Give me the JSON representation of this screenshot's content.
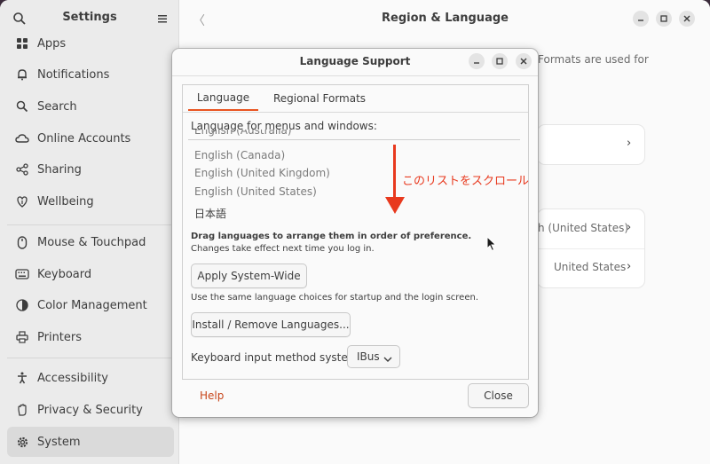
{
  "sidebar": {
    "title": "Settings",
    "items": [
      {
        "label": "Apps",
        "icon": "apps-icon"
      },
      {
        "label": "Notifications",
        "icon": "bell-icon"
      },
      {
        "label": "Search",
        "icon": "search-icon"
      },
      {
        "label": "Online Accounts",
        "icon": "cloud-icon"
      },
      {
        "label": "Sharing",
        "icon": "share-icon"
      },
      {
        "label": "Wellbeing",
        "icon": "wellbeing-icon"
      },
      {
        "label": "Mouse & Touchpad",
        "icon": "mouse-icon"
      },
      {
        "label": "Keyboard",
        "icon": "keyboard-icon"
      },
      {
        "label": "Color Management",
        "icon": "color-icon"
      },
      {
        "label": "Printers",
        "icon": "printer-icon"
      },
      {
        "label": "Accessibility",
        "icon": "accessibility-icon"
      },
      {
        "label": "Privacy & Security",
        "icon": "hand-icon"
      },
      {
        "label": "System",
        "icon": "gear-icon"
      }
    ],
    "active": "System"
  },
  "main": {
    "title": "Region & Language",
    "formats_fragment": "Formats are used for",
    "row1_value": "h (United States)",
    "row2_value": "United States"
  },
  "dialog": {
    "title": "Language Support",
    "tabs": [
      "Language",
      "Regional Formats"
    ],
    "active_tab": "Language",
    "list_label": "Language for menus and windows:",
    "languages": [
      "English (Australia)",
      "English (Canada)",
      "English (United Kingdom)",
      "English (United States)",
      "日本語"
    ],
    "drag_hint": "Drag languages to arrange them in order of preference.",
    "drag_note": "Changes take effect next time you log in.",
    "apply_button": "Apply System-Wide",
    "apply_note": "Use the same language choices for startup and the login screen.",
    "install_button": "Install / Remove Languages...",
    "input_method_label": "Keyboard input method system:",
    "input_method_value": "IBus",
    "help_label": "Help",
    "close_label": "Close"
  },
  "annotation": {
    "text": "このリストをスクロール",
    "color": "#e8391e"
  },
  "colors": {
    "accent": "#e95420",
    "help_link": "#c7451a"
  }
}
